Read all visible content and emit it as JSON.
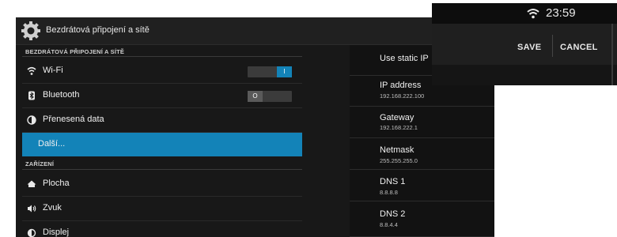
{
  "titlebar": {
    "title": "Bezdrátová připojení a sítě",
    "icon": "gear-icon"
  },
  "sections": {
    "wireless": "BEZDRÁTOVÁ PŘIPOJENÍ A SÍTĚ",
    "device": "ZAŘÍZENÍ"
  },
  "items": {
    "wifi": {
      "label": "Wi-Fi",
      "toggle": "I",
      "state": "on"
    },
    "bluetooth": {
      "label": "Bluetooth",
      "toggle": "O",
      "state": "off"
    },
    "data": {
      "label": "Přenesená data"
    },
    "more": {
      "label": "Další..."
    },
    "home": {
      "label": "Plocha"
    },
    "sound": {
      "label": "Zvuk"
    },
    "display": {
      "label": "Displej"
    }
  },
  "ip_settings": {
    "static": {
      "label": "Use static IP"
    },
    "ip": {
      "label": "IP address",
      "value": "192.168.222.100"
    },
    "gateway": {
      "label": "Gateway",
      "value": "192.168.222.1"
    },
    "netmask": {
      "label": "Netmask",
      "value": "255.255.255.0"
    },
    "dns1": {
      "label": "DNS 1",
      "value": "8.8.8.8"
    },
    "dns2": {
      "label": "DNS 2",
      "value": "8.8.4.4"
    }
  },
  "overlay": {
    "time": "23:59",
    "save_label": "SAVE",
    "cancel_label": "CANCEL"
  },
  "colors": {
    "accent": "#1383b8",
    "toggle_on": "#1383b8",
    "background": "#181818"
  }
}
